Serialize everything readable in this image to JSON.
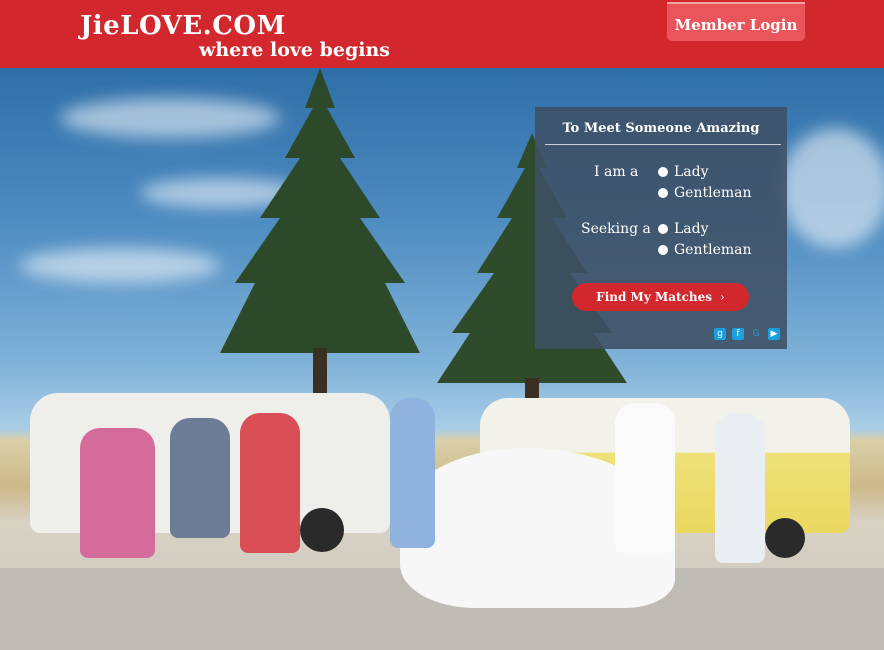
{
  "header": {
    "logo_main": "JieLOVE.COM",
    "logo_sub": "where love begins",
    "login_label": "Member Login",
    "brand_color": "#d2272c"
  },
  "panel": {
    "title": "To Meet Someone Amazing",
    "iam_label": "I am a",
    "iam_options": [
      "Lady",
      "Gentleman"
    ],
    "seeking_label": "Seeking a",
    "seeking_options": [
      "Lady",
      "Gentleman"
    ],
    "button_label": "Find My Matches",
    "button_icon": "chevron-right-icon",
    "social_icons": [
      "google-plus-icon",
      "facebook-icon",
      "google-icon",
      "youtube-icon"
    ]
  },
  "hero": {
    "image": "wedding-group-photo"
  }
}
